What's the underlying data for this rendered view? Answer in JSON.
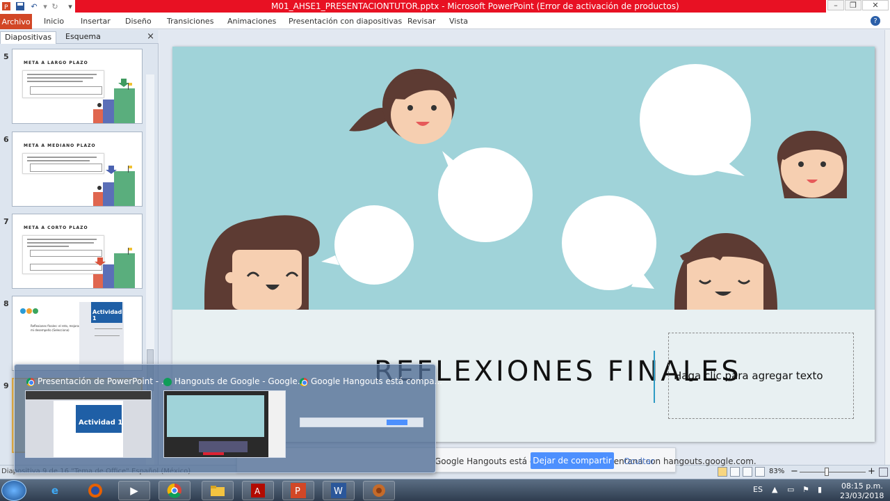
{
  "window": {
    "title": "M01_AHSE1_PRESENTACIONTUTOR.pptx - Microsoft PowerPoint (Error de activación de productos)"
  },
  "ribbon": {
    "file_tab": "Archivo",
    "tabs": [
      "Inicio",
      "Insertar",
      "Diseño",
      "Transiciones",
      "Animaciones",
      "Presentación con diapositivas",
      "Revisar",
      "Vista"
    ]
  },
  "left_pane": {
    "tabs": [
      "Diapositivas",
      "Esquema"
    ],
    "close": "×",
    "slides": [
      {
        "number": "5",
        "title": "META A LARGO PLAZO"
      },
      {
        "number": "6",
        "title": "META A MEDIANO PLAZO"
      },
      {
        "number": "7",
        "title": "META A CORTO PLAZO"
      },
      {
        "number": "8",
        "title": "Actividad 1",
        "subtitle": "Reflexiones finales: el reto, mejorar mi desempeño (Selecciona)"
      },
      {
        "number": "9"
      }
    ]
  },
  "slide": {
    "title": "REFLEXIONES FINALES",
    "placeholder": "Haga clic para agregar texto"
  },
  "status_bar": {
    "left_text": "Diapositiva 9 de 16   \"Tema de Office\"   Español (México)",
    "zoom": "83%",
    "zoom_level_percent": 83,
    "minus": "−",
    "plus": "+"
  },
  "share_bar": {
    "message": "Google Hangouts está compartiendo una ventana con hangouts.google.com.",
    "stop_button": "Dejar de compartir",
    "hide_button": "Ocultar"
  },
  "taskbar_popup": {
    "items": [
      {
        "title": "Presentación de PowerPoint - ...",
        "preview_heading": "Actividad 1"
      },
      {
        "title": "Hangouts de Google - Google..."
      },
      {
        "title": "Google Hangouts está compa..."
      }
    ]
  },
  "taskbar": {
    "language": "ES",
    "time": "08:15 p.m.",
    "date": "23/03/2018"
  },
  "colors": {
    "title_bar_red": "#e81123",
    "file_tab": "#d24726",
    "slide_sky": "#a0d3d9",
    "accent_line": "#2e9bc4",
    "share_button": "#4d90fe"
  }
}
